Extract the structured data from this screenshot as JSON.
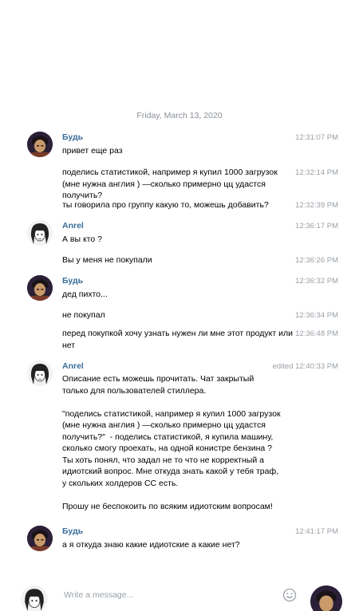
{
  "date_separator": "Friday, March 13, 2020",
  "messages": [
    {
      "sender": "Будь",
      "text": "привет еще раз",
      "time": "12:31:07 PM"
    },
    {
      "text": "поделись статистикой, например я купил 1000 загрузок (мне нужна англия ) —сколько примерно цц удастся получить?",
      "time": "12:32:14 PM"
    },
    {
      "text": "ты говорила про группу какую то, можешь добавить?",
      "time": "12:32:39 PM"
    },
    {
      "sender": "Anrel",
      "text": "А вы кто ?",
      "time": "12:36:17 PM"
    },
    {
      "text": "Вы у меня не покупали",
      "time": "12:36:26 PM"
    },
    {
      "sender": "Будь",
      "text": "дед пихто...",
      "time": "12:36:32 PM"
    },
    {
      "text": "не покупал",
      "time": "12:36:34 PM"
    },
    {
      "text": "перед покупкой хочу узнать нужен ли мне этот продукт или нет",
      "time": "12:36:48 PM"
    },
    {
      "sender": "Anrel",
      "text": "Описание есть можешь прочитать. Чат закрытый только для пользователей стиллера.\n\n\"поделись статистикой, например я купил 1000 загрузок (мне нужна англия ) —сколько примерно цц удастся получить?\"  - поделись статистикой, я купила машину, сколько смогу проехать, на одной конистре бензина ?\nТы хоть понял, что задал не то что не корректный а идиотский вопрос. Мне откуда знать какой у тебя траф, у скольких холдеров СС есть.\n\nПрошу не беспокоить по всяким идиотским вопросам!",
      "time": "edited 12:40:33 PM"
    },
    {
      "sender": "Будь",
      "text": "а я откуда знаю какие идиотские а какие нет?",
      "time": "12:41:17 PM"
    }
  ],
  "composer": {
    "placeholder": "Write a message..."
  },
  "icons": {
    "emoji": "smiley-icon"
  },
  "colors": {
    "sender_name": "#3a6d99",
    "timestamp": "#9aa0a6",
    "date": "#8a8f95"
  }
}
